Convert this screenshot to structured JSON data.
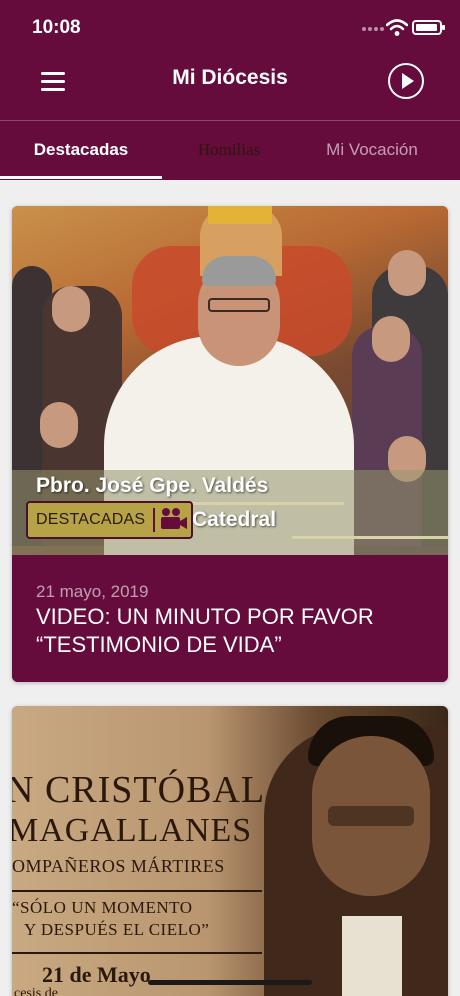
{
  "status_bar": {
    "time": "10:08"
  },
  "header": {
    "title": "Mi Diócesis"
  },
  "tabs": [
    {
      "label": "Destacadas",
      "active": true
    },
    {
      "label": "Homilias",
      "active": false
    },
    {
      "label": "Mi Vocación",
      "active": false
    }
  ],
  "colors": {
    "brand": "#650c3d",
    "badge": "#b6a345",
    "background": "#efefef"
  },
  "icons": {
    "menu": "hamburger-menu-icon",
    "play": "play-circle-icon",
    "video": "video-camera-icon"
  },
  "cards": [
    {
      "thumbnail_text": {
        "name": "Pbro. José Gpe. Valdés",
        "place": "Catedral"
      },
      "badge": "DESTACADAS",
      "date": "21 mayo, 2019",
      "title_line1": "VIDEO: UN MINUTO POR FAVOR",
      "title_line2": "“TESTIMONIO DE VIDA”"
    },
    {
      "thumbnail_text": {
        "line1": "N CRISTÓBAL",
        "line2": "MAGALLANES",
        "line3": "OMPAÑEROS MÁRTIRES",
        "line4": "“SÓLO UN MOMENTO",
        "line5": "Y DESPUÉS EL CIELO”",
        "line6": "21 de Mayo",
        "line7": "cesis de"
      }
    }
  ]
}
